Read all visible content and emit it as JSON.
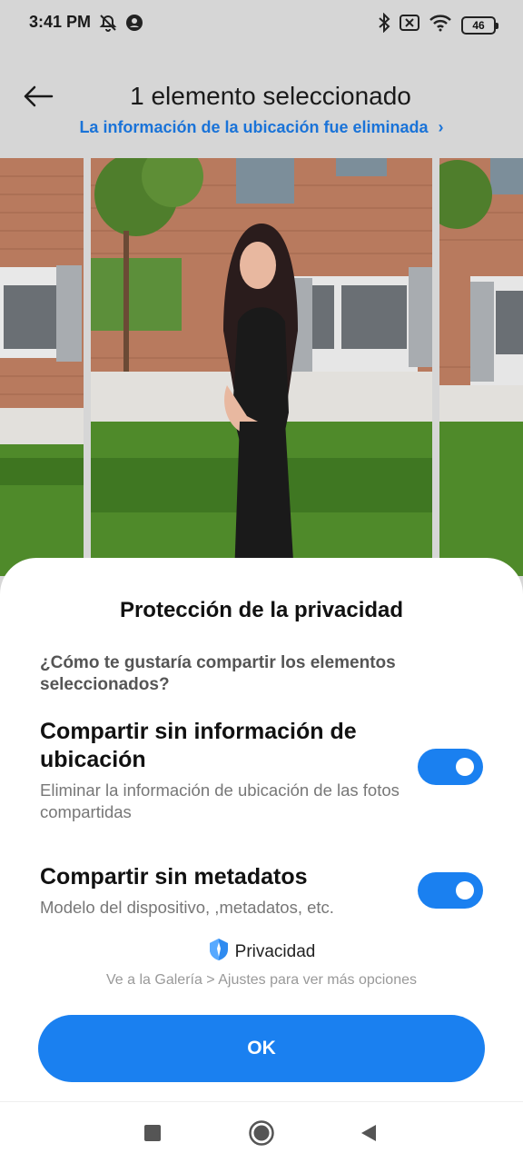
{
  "status_bar": {
    "time": "3:41 PM",
    "battery": "46"
  },
  "header": {
    "title": "1 elemento seleccionado",
    "location_notice": "La información de la ubicación fue eliminada",
    "location_chevron": "›"
  },
  "sheet": {
    "title": "Protección de la privacidad",
    "question": "¿Cómo te gustaría compartir los elementos seleccionados?",
    "options": [
      {
        "title": "Compartir sin información de ubicación",
        "description": "Eliminar la información de ubicación de las fotos compartidas",
        "enabled": true
      },
      {
        "title": "Compartir sin metadatos",
        "description": "Modelo del dispositivo, ,metadatos, etc.",
        "enabled": true
      }
    ],
    "brand_label": "Privacidad",
    "hint": "Ve a la Galería > Ajustes para ver más opciones",
    "ok_label": "OK"
  },
  "colors": {
    "accent": "#1a80f0",
    "link": "#1a73d8",
    "background": "#d6d6d6"
  },
  "icons": {
    "status_left": [
      "alarm-off-icon",
      "account-icon"
    ],
    "status_right": [
      "bluetooth-icon",
      "no-sim-icon",
      "wifi-icon",
      "battery-icon"
    ],
    "nav": [
      "recents-square-icon",
      "home-circle-icon",
      "back-triangle-icon"
    ]
  }
}
